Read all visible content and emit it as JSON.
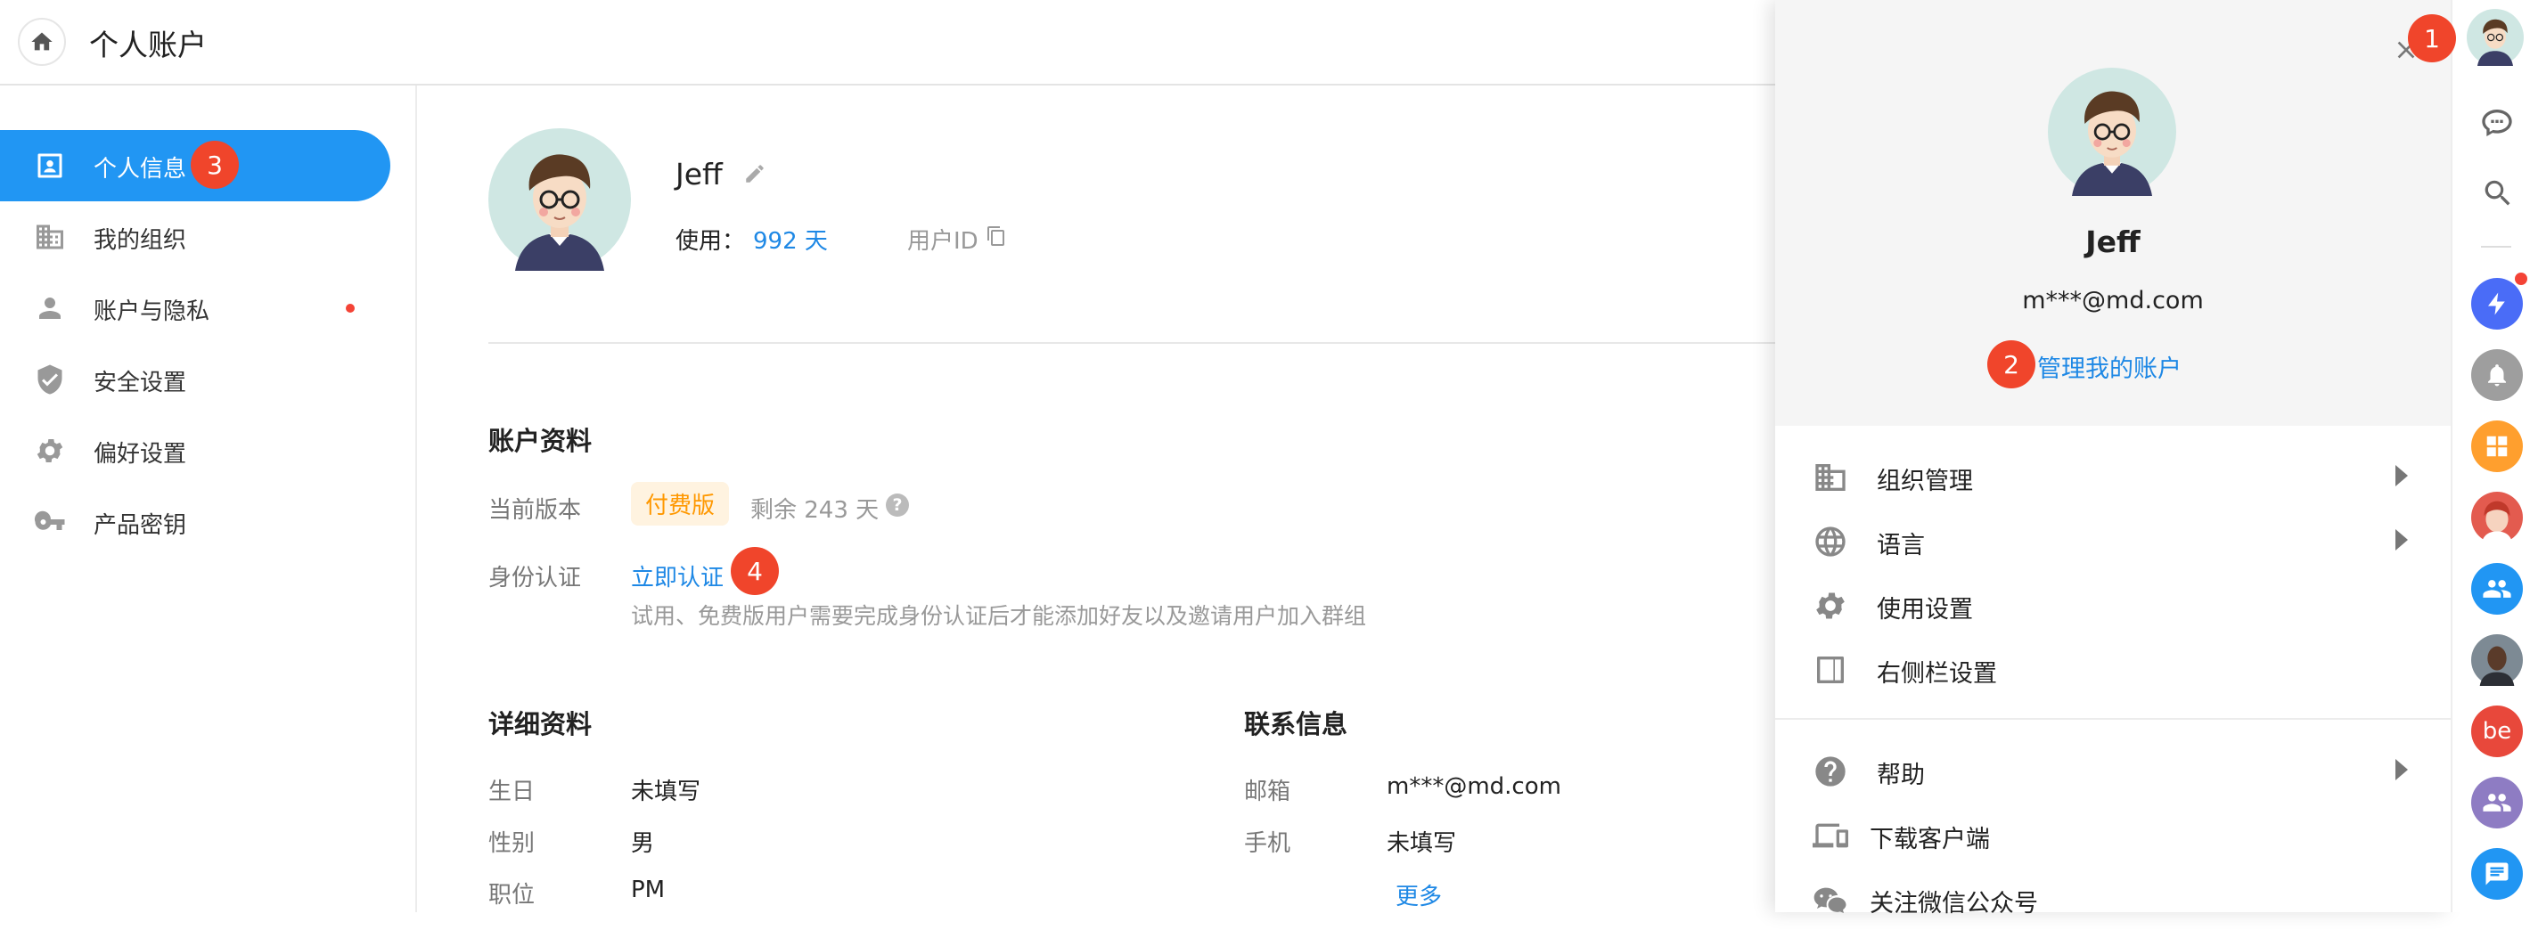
{
  "header": {
    "title": "个人账户"
  },
  "sidebar": {
    "items": [
      {
        "label": "个人信息",
        "icon": "contact-card-icon",
        "active": true
      },
      {
        "label": "我的组织",
        "icon": "building-icon"
      },
      {
        "label": "账户与隐私",
        "icon": "person-icon",
        "dot": true
      },
      {
        "label": "安全设置",
        "icon": "shield-check-icon"
      },
      {
        "label": "偏好设置",
        "icon": "gear-icon"
      },
      {
        "label": "产品密钥",
        "icon": "key-icon"
      }
    ]
  },
  "profile": {
    "name": "Jeff",
    "usage_label": "使用：",
    "usage_value": "992 天",
    "userid_label": "用户ID"
  },
  "account": {
    "section_title": "账户资料",
    "version_label": "当前版本",
    "version_badge": "付费版",
    "remaining": "剩余 243 天",
    "identity_label": "身份认证",
    "identity_link": "立即认证",
    "identity_note": "试用、免费版用户需要完成身份认证后才能添加好友以及邀请用户加入群组"
  },
  "details": {
    "section_title": "详细资料",
    "rows": [
      {
        "label": "生日",
        "value": "未填写"
      },
      {
        "label": "性别",
        "value": "男"
      },
      {
        "label": "职位",
        "value": "PM"
      }
    ]
  },
  "contact": {
    "section_title": "联系信息",
    "rows": [
      {
        "label": "邮箱",
        "value": "m***@md.com"
      },
      {
        "label": "手机",
        "value": "未填写"
      }
    ],
    "more": "更多"
  },
  "panel": {
    "name": "Jeff",
    "email": "m***@md.com",
    "manage_link": "管理我的账户",
    "menu": [
      {
        "label": "组织管理",
        "icon": "building-icon",
        "arrow": true
      },
      {
        "label": "语言",
        "icon": "globe-icon",
        "arrow": true
      },
      {
        "label": "使用设置",
        "icon": "gear-icon"
      },
      {
        "label": "右侧栏设置",
        "icon": "sidebar-panel-icon"
      },
      {
        "label": "帮助",
        "icon": "help-circle-icon",
        "arrow": true
      },
      {
        "label": "下载客户端",
        "icon": "devices-icon"
      },
      {
        "label": "关注微信公众号",
        "icon": "wechat-icon"
      }
    ]
  },
  "annotations": [
    "1",
    "2",
    "3",
    "4"
  ],
  "rail": {
    "avatar_text": "be"
  },
  "colors": {
    "primary": "#2196f3",
    "link": "#1e88e5",
    "badge_red": "#f0452b",
    "paid_orange": "#ff9800",
    "paid_bg": "#fff3e0"
  }
}
